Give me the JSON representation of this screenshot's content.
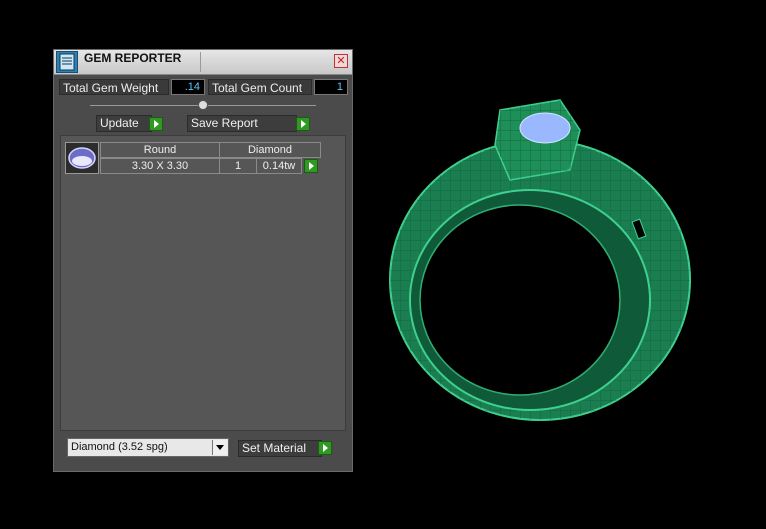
{
  "window": {
    "title": "GEM REPORTER",
    "close_glyph": "✕"
  },
  "summary": {
    "total_weight_label": "Total Gem Weight",
    "total_weight_value": ".14",
    "total_count_label": "Total Gem Count",
    "total_count_value": "1"
  },
  "actions": {
    "update_label": "Update",
    "save_report_label": "Save Report",
    "set_material_label": "Set Material"
  },
  "gems": [
    {
      "shape": "Round",
      "material": "Diamond",
      "size": "3.30 X 3.30",
      "count": "1",
      "weight": "0.14tw"
    }
  ],
  "material_select": {
    "selected": "Diamond     (3.52 spg)"
  },
  "colors": {
    "panel_bg": "#4b4b4b",
    "accent_green": "#2f9a22",
    "field_text": "#5cc8ff",
    "ring_green": "#1f8f5a",
    "gem_blue": "#9ab8ff"
  },
  "icons": {
    "app": "gem-reporter-icon",
    "close": "close-icon",
    "go": "play-arrow-icon",
    "dropdown": "chevron-down-icon"
  }
}
